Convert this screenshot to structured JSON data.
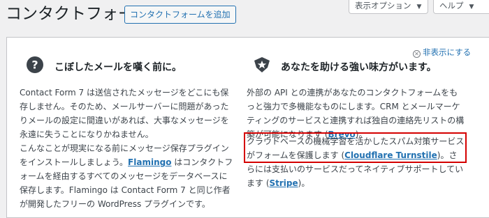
{
  "header": {
    "title": "コンタクトフォーム",
    "add_new": "コンタクトフォームを追加",
    "screen_options": "表示オプション",
    "help": "ヘルプ"
  },
  "welcome": {
    "dismiss": "非表示にする",
    "left": {
      "title": "こぼしたメールを嘆く前に。",
      "p1": "Contact Form 7 は送信されたメッセージをどこにも保存しません。そのため、メールサーバーに問題があったりメールの設定に間違いがあれば、大事なメッセージを永遠に失うことになりかねません。",
      "p2_a": "こんなことが現実になる前にメッセージ保存プラグインをインストールしましょう。",
      "p2_link": "Flamingo",
      "p2_b": " はコンタクトフォームを経由するすべてのメッセージをデータベースに保存します。Flamingo は Contact Form 7 と同じ作者が開発したフリーの WordPress プラグインです。"
    },
    "right": {
      "title": "あなたを助ける強い味方がいます。",
      "p1_a": "外部の API との連携があなたのコンタクトフォームをもっと強力で多機能なものにします。CRM とメールマーケティングのサービスと連携すれば独自の連絡先リストの構築が可能になります (",
      "p1_link": "Brevo",
      "p1_b": ")。",
      "p2_a": "クラウドベースの機械学習を活かしたスパム対策サービスがフォームを保護します (",
      "p2_link1": "Cloudflare Turnstile",
      "p2_b": ")。さらには支払いのサービスだってネイティブサポートしています (",
      "p2_link2": "Stripe",
      "p2_c": ")。"
    }
  }
}
